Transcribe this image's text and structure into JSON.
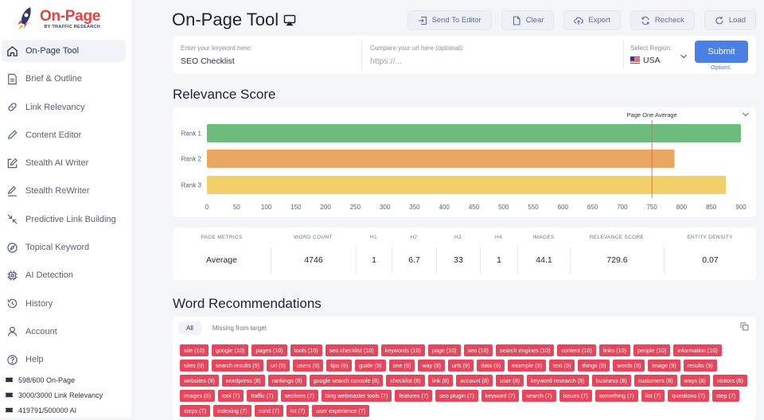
{
  "app": {
    "logo_title": "On-Page",
    "logo_subtitle": "BY TRAFFIC RESEARCH"
  },
  "sidebar": {
    "items": [
      {
        "label": "On-Page Tool",
        "icon": "home-icon",
        "active": true
      },
      {
        "label": "Brief & Outline",
        "icon": "document-icon"
      },
      {
        "label": "Link Relevancy",
        "icon": "link-icon"
      },
      {
        "label": "Content Editor",
        "icon": "pencil-icon"
      },
      {
        "label": "Stealth AI Writer",
        "icon": "edit-square-icon"
      },
      {
        "label": "Stealth ReWriter",
        "icon": "pen-line-icon"
      },
      {
        "label": "Predictive Link Building",
        "icon": "arrows-in-icon"
      },
      {
        "label": "Topical Keyword",
        "icon": "compass-icon"
      },
      {
        "label": "AI Detection",
        "icon": "chip-icon"
      },
      {
        "label": "History",
        "icon": "history-icon"
      },
      {
        "label": "Account",
        "icon": "user-icon"
      },
      {
        "label": "Help",
        "icon": "help-icon"
      }
    ],
    "usage": [
      {
        "label": "598/600 On-Page"
      },
      {
        "label": "3000/3000 Link Relevancy"
      },
      {
        "label": "419791/500000 AI"
      }
    ]
  },
  "header": {
    "title": "On-Page Tool",
    "actions": [
      {
        "label": "Send To Editor",
        "icon": "send-icon"
      },
      {
        "label": "Clear",
        "icon": "file-icon"
      },
      {
        "label": "Export",
        "icon": "cloud-upload-icon"
      },
      {
        "label": "Recheck",
        "icon": "refresh-icon"
      },
      {
        "label": "Load",
        "icon": "reload-icon"
      }
    ]
  },
  "form": {
    "keyword_label": "Enter your keyword here:",
    "keyword_value": "SEO Checklist",
    "url_label": "Compare your url here (optional):",
    "url_placeholder": "https://...",
    "region_label": "Select Region:",
    "region_value": "USA",
    "submit_label": "Submit",
    "options_label": "Options"
  },
  "relevance": {
    "title": "Relevance Score",
    "chart_data": {
      "type": "bar",
      "orientation": "horizontal",
      "categories": [
        "Rank 1",
        "Rank 2",
        "Rank 3"
      ],
      "values": [
        900,
        788,
        875
      ],
      "colors": [
        "#6dbb7d",
        "#e9a762",
        "#f3cf6a"
      ],
      "xlim": [
        0,
        900
      ],
      "xticks": [
        0,
        50,
        100,
        150,
        200,
        250,
        300,
        350,
        400,
        450,
        500,
        550,
        600,
        650,
        700,
        750,
        800,
        850,
        900
      ],
      "reference_line": {
        "label": "Page One Average",
        "value": 750,
        "color": "#e06b6b"
      },
      "grid": false
    }
  },
  "metrics": {
    "headers": [
      "PAGE METRICS",
      "WORD COUNT",
      "H1",
      "H2",
      "H3",
      "H4",
      "IMAGES",
      "RELEVANCE SCORE",
      "ENTITY DENSITY"
    ],
    "row": [
      "Average",
      "4746",
      "1",
      "6.7",
      "33",
      "1",
      "44.1",
      "729.6",
      "0.07"
    ]
  },
  "words": {
    "title": "Word Recommendations",
    "tabs": [
      {
        "label": "All",
        "active": true
      },
      {
        "label": "Missing from target"
      }
    ],
    "tag_color": "#e5465c",
    "tags": [
      "site (10)",
      "google (10)",
      "pages (10)",
      "tools (10)",
      "seo checklist (10)",
      "keywords (10)",
      "page (10)",
      "seo (10)",
      "search engines (10)",
      "content (10)",
      "links (10)",
      "people (10)",
      "information (10)",
      "sites (9)",
      "search results (9)",
      "url (9)",
      "users (9)",
      "tips (9)",
      "guide (9)",
      "one (9)",
      "way (9)",
      "urls (9)",
      "data (9)",
      "example (9)",
      "text (9)",
      "things (9)",
      "words (9)",
      "image (9)",
      "results (9)",
      "websites (9)",
      "wordpress (8)",
      "rankings (8)",
      "google search console (8)",
      "checklist (8)",
      "link (8)",
      "account (8)",
      "user (8)",
      "keyword research (8)",
      "business (8)",
      "customers (8)",
      "ways (8)",
      "visitors (8)",
      "images (8)",
      "tool (7)",
      "traffic (7)",
      "sections (7)",
      "bing webmaster tools (7)",
      "features (7)",
      "seo plugin (7)",
      "keyword (7)",
      "search (7)",
      "issues (7)",
      "something (7)",
      "list (7)",
      "questions (7)",
      "step (7)",
      "steps (7)",
      "indexing (7)",
      "mind (7)",
      "lot (7)",
      "user experience (7)"
    ]
  }
}
